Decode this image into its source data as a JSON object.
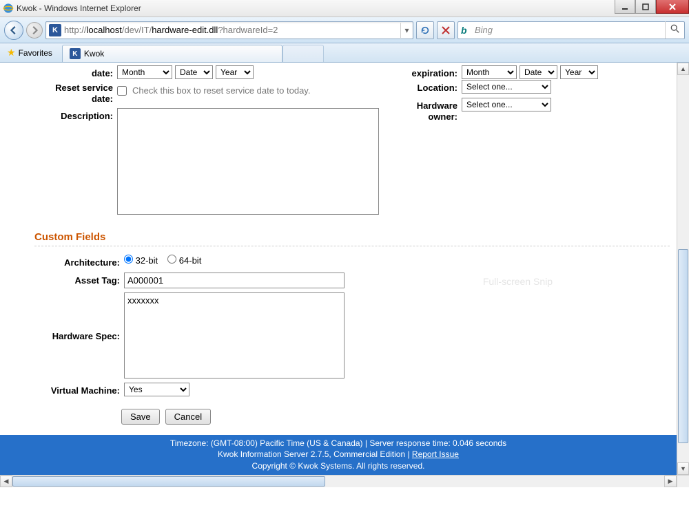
{
  "window": {
    "title": "Kwok - Windows Internet Explorer"
  },
  "nav": {
    "url_grey_pre": "http://",
    "url_host": "localhost",
    "url_grey_mid": "/dev/IT/",
    "url_page": "hardware-edit.dll",
    "url_grey_post": "?hardwareId=2",
    "search_engine": "Bing"
  },
  "favbar": {
    "favorites_label": "Favorites",
    "tab_title": "Kwok"
  },
  "form": {
    "left": {
      "date_label": "date:",
      "date_month": "Month",
      "date_date": "Date",
      "date_year": "Year",
      "reset_label_l1": "Reset service",
      "reset_label_l2": "date:",
      "reset_chk_text": "Check this box to reset service date to today.",
      "description_label": "Description:",
      "description_value": ""
    },
    "right": {
      "expiration_label": "expiration:",
      "exp_month": "Month",
      "exp_date": "Date",
      "exp_year": "Year",
      "location_label": "Location:",
      "location_value": "Select one...",
      "owner_label_l1": "Hardware",
      "owner_label_l2": "owner:",
      "owner_value": "Select one..."
    },
    "custom_heading": "Custom Fields",
    "arch": {
      "label": "Architecture:",
      "opt1": "32-bit",
      "opt2": "64-bit"
    },
    "asset_tag": {
      "label": "Asset Tag:",
      "value": "A000001"
    },
    "hw_spec": {
      "label": "Hardware Spec:",
      "value": "xxxxxxx"
    },
    "vm": {
      "label": "Virtual Machine:",
      "value": "Yes"
    },
    "save_btn": "Save",
    "cancel_btn": "Cancel"
  },
  "footer": {
    "line1a": "Timezone: (GMT-08:00) Pacific Time (US & Canada) | Server response time: 0.046 seconds",
    "line2a": "Kwok Information Server 2.7.5, Commercial Edition | ",
    "line2_link": "Report Issue",
    "line3": "Copyright © Kwok Systems. All rights reserved."
  },
  "ghost_text": "Full-screen Snip"
}
